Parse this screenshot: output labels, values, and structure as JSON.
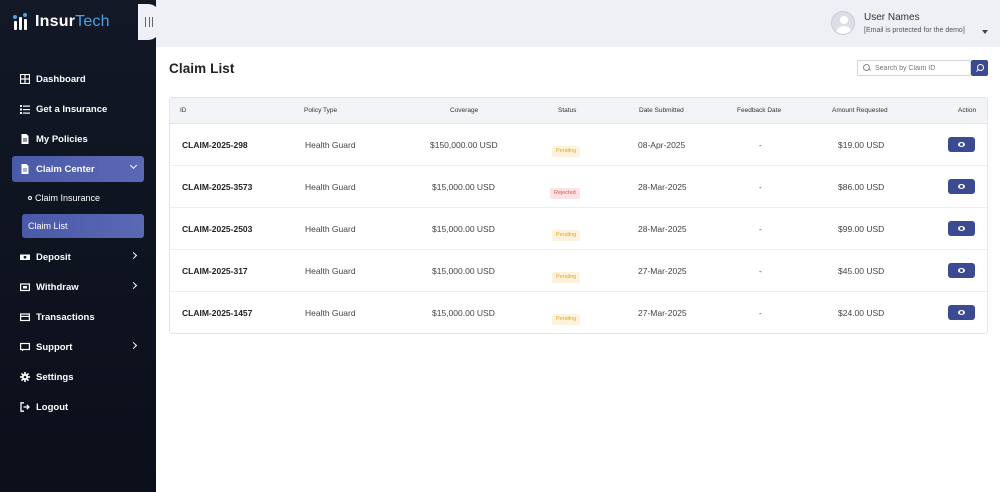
{
  "app": {
    "logo_main": "Insur",
    "logo_accent": "Tech"
  },
  "sidebar": {
    "items": [
      {
        "label": "Dashboard",
        "icon": "grid-icon"
      },
      {
        "label": "Get a Insurance",
        "icon": "list-icon"
      },
      {
        "label": "My Policies",
        "icon": "document-icon"
      },
      {
        "label": "Claim Center",
        "icon": "document-icon",
        "active": true,
        "expanded": true
      },
      {
        "label": "Deposit",
        "icon": "money-icon",
        "has_submenu": true
      },
      {
        "label": "Withdraw",
        "icon": "wallet-icon",
        "has_submenu": true
      },
      {
        "label": "Transactions",
        "icon": "card-icon"
      },
      {
        "label": "Support",
        "icon": "chat-icon",
        "has_submenu": true
      },
      {
        "label": "Settings",
        "icon": "gear-icon"
      },
      {
        "label": "Logout",
        "icon": "logout-icon"
      }
    ],
    "claim_submenu": [
      {
        "label": "Claim Insurance"
      },
      {
        "label": "Claim List",
        "active": true
      }
    ]
  },
  "topbar": {
    "user_name": "User Names",
    "user_email": "[Email is protected for the demo]"
  },
  "main": {
    "title": "Claim List",
    "search_placeholder": "Search by Claim ID",
    "columns": [
      "ID",
      "Policy Type",
      "Coverage",
      "Status",
      "Date Submitted",
      "Feedback Date",
      "Amount Requested",
      "Action"
    ],
    "rows": [
      {
        "id": "CLAIM-2025-298",
        "policy": "Health Guard",
        "coverage": "$150,000.00 USD",
        "status": "Pending",
        "submitted": "08-Apr-2025",
        "feedback": "-",
        "amount": "$19.00 USD"
      },
      {
        "id": "CLAIM-2025-3573",
        "policy": "Health Guard",
        "coverage": "$15,000.00 USD",
        "status": "Rejected",
        "submitted": "28-Mar-2025",
        "feedback": "-",
        "amount": "$86.00 USD"
      },
      {
        "id": "CLAIM-2025-2503",
        "policy": "Health Guard",
        "coverage": "$15,000.00 USD",
        "status": "Pending",
        "submitted": "28-Mar-2025",
        "feedback": "-",
        "amount": "$99.00 USD"
      },
      {
        "id": "CLAIM-2025-317",
        "policy": "Health Guard",
        "coverage": "$15,000.00 USD",
        "status": "Pending",
        "submitted": "27-Mar-2025",
        "feedback": "-",
        "amount": "$45.00 USD"
      },
      {
        "id": "CLAIM-2025-1457",
        "policy": "Health Guard",
        "coverage": "$15,000.00 USD",
        "status": "Pending",
        "submitted": "27-Mar-2025",
        "feedback": "-",
        "amount": "$24.00 USD"
      }
    ]
  },
  "colors": {
    "sidebar_bg": "#121826",
    "accent": "#4a5aa8",
    "button": "#3c4a91",
    "pending": "#e0a529",
    "rejected": "#d9534f"
  }
}
